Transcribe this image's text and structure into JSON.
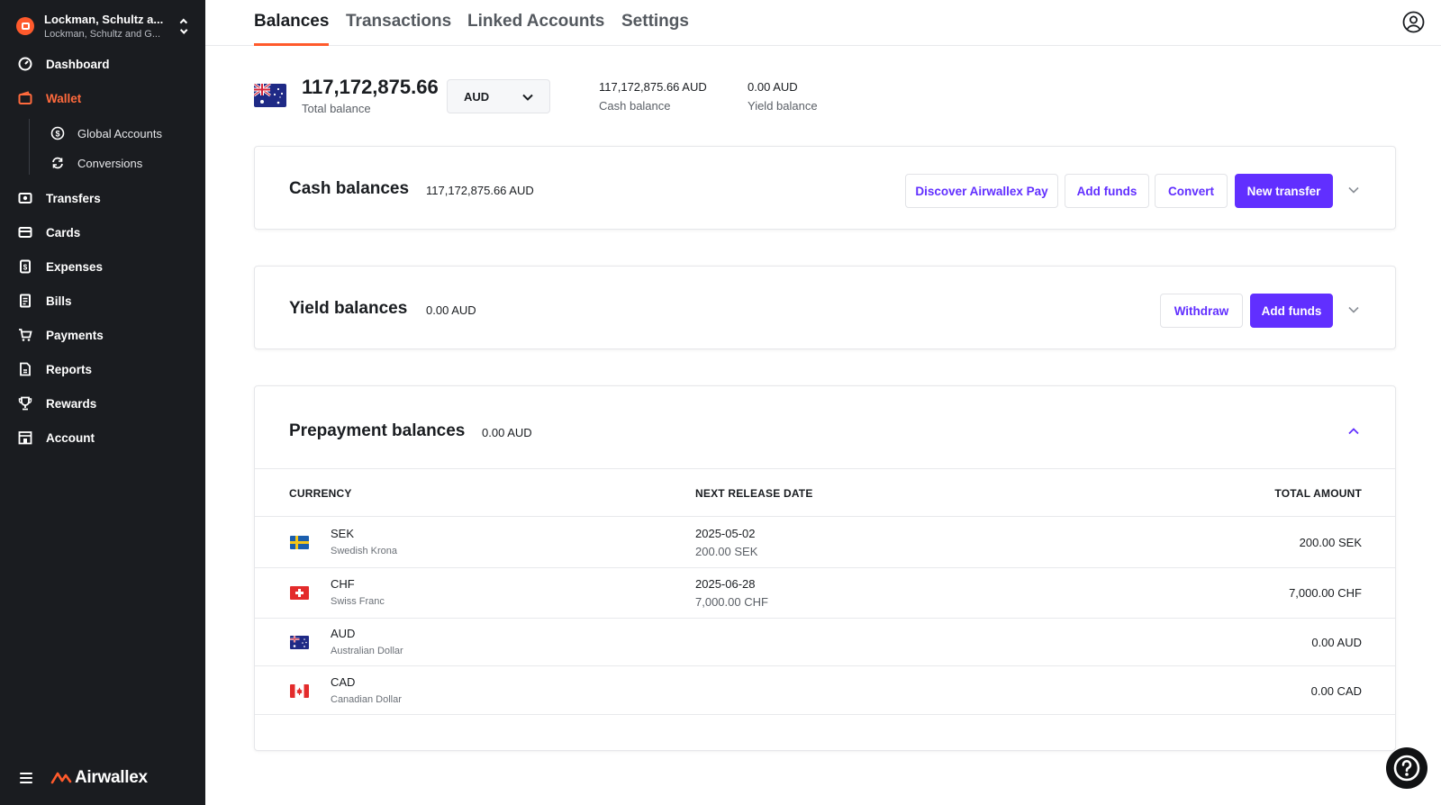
{
  "org": {
    "name": "Lockman, Schultz a...",
    "subtitle": "Lockman, Schultz and G..."
  },
  "sidebar": {
    "items": [
      {
        "label": "Dashboard",
        "icon": "dashboard-icon"
      },
      {
        "label": "Wallet",
        "icon": "wallet-icon",
        "active": true
      },
      {
        "label": "Transfers",
        "icon": "transfers-icon"
      },
      {
        "label": "Cards",
        "icon": "card-icon"
      },
      {
        "label": "Expenses",
        "icon": "expenses-icon"
      },
      {
        "label": "Bills",
        "icon": "bills-icon"
      },
      {
        "label": "Payments",
        "icon": "cart-icon"
      },
      {
        "label": "Reports",
        "icon": "report-icon"
      },
      {
        "label": "Rewards",
        "icon": "trophy-icon"
      },
      {
        "label": "Account",
        "icon": "building-icon"
      }
    ],
    "wallet_sub": [
      {
        "label": "Global Accounts",
        "icon": "dollar-circle-icon"
      },
      {
        "label": "Conversions",
        "icon": "refresh-icon"
      }
    ],
    "brand": "Airwallex"
  },
  "tabs": [
    "Balances",
    "Transactions",
    "Linked Accounts",
    "Settings"
  ],
  "summary": {
    "total_value": "117,172,875.66",
    "total_label": "Total balance",
    "currency": "AUD",
    "cash_value": "117,172,875.66 AUD",
    "cash_label": "Cash balance",
    "yield_value": "0.00 AUD",
    "yield_label": "Yield balance"
  },
  "cash": {
    "title": "Cash balances",
    "amount": "117,172,875.66 AUD",
    "buttons": {
      "discover": "Discover Airwallex Pay",
      "add_funds": "Add funds",
      "convert": "Convert",
      "new_transfer": "New transfer"
    }
  },
  "yield": {
    "title": "Yield balances",
    "amount": "0.00 AUD",
    "buttons": {
      "withdraw": "Withdraw",
      "add_funds": "Add funds"
    }
  },
  "prepayment": {
    "title": "Prepayment balances",
    "amount": "0.00 AUD",
    "columns": {
      "currency": "CURRENCY",
      "next_release": "NEXT RELEASE DATE",
      "total": "TOTAL AMOUNT"
    },
    "rows": [
      {
        "code": "SEK",
        "name": "Swedish Krona",
        "date": "2025-05-02",
        "date_amount": "200.00 SEK",
        "total": "200.00 SEK"
      },
      {
        "code": "CHF",
        "name": "Swiss Franc",
        "date": "2025-06-28",
        "date_amount": "7,000.00 CHF",
        "total": "7,000.00 CHF"
      },
      {
        "code": "AUD",
        "name": "Australian Dollar",
        "date": "",
        "date_amount": "",
        "total": "0.00 AUD"
      },
      {
        "code": "CAD",
        "name": "Canadian Dollar",
        "date": "",
        "date_amount": "",
        "total": "0.00 CAD"
      }
    ]
  },
  "colors": {
    "accent": "#612fff",
    "brand": "#ff5a2c",
    "sidebar": "#1a1c20"
  }
}
